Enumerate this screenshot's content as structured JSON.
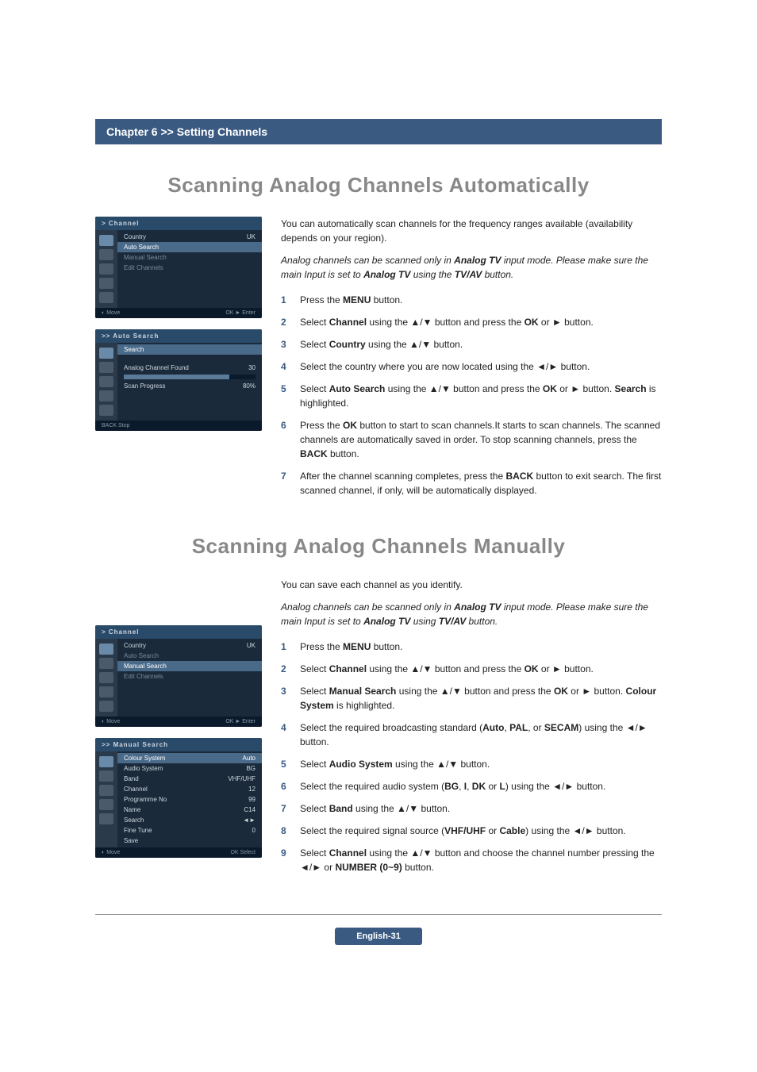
{
  "chapter_bar": "Chapter 6 >> Setting Channels",
  "section1": {
    "title": "Scanning Analog Channels Automatically",
    "intro": "You can automatically scan channels for the frequency ranges available (availability depends on your region).",
    "note_prefix": "Analog channels can be scanned only in ",
    "note_bold1": "Analog TV",
    "note_mid": " input mode. Please make sure the main Input is set to ",
    "note_bold2": "Analog TV",
    "note_suffix": " using the ",
    "note_bold3": "TV/AV",
    "note_end": " button.",
    "steps": {
      "s1a": "Press the ",
      "s1b": "MENU",
      "s1c": " button.",
      "s2a": "Select ",
      "s2b": "Channel",
      "s2c": " using the ▲/▼ button and press the ",
      "s2d": "OK",
      "s2e": " or ► button.",
      "s3a": "Select ",
      "s3b": "Country",
      "s3c": " using the ▲/▼ button.",
      "s4": "Select the country where you are now located using the ◄/► button.",
      "s5a": "Select ",
      "s5b": "Auto Search",
      "s5c": " using the ▲/▼ button and press the ",
      "s5d": "OK",
      "s5e": " or ► button. ",
      "s5f": "Search",
      "s5g": " is highlighted.",
      "s6a": "Press the ",
      "s6b": "OK",
      "s6c": " button to start to scan channels.It starts to scan channels. The scanned channels are automatically saved in order. To stop scanning channels, press the ",
      "s6d": "BACK",
      "s6e": " button.",
      "s7a": "After the channel scanning completes, press the ",
      "s7b": "BACK",
      "s7c": " button to exit search. The first scanned channel, if only, will be automatically displayed."
    },
    "osd1": {
      "title": "> Channel",
      "rows": [
        {
          "l": "Country",
          "r": "UK"
        },
        {
          "l": "Auto Search",
          "r": ""
        },
        {
          "l": "Manual Search",
          "r": ""
        },
        {
          "l": "Edit Channels",
          "r": ""
        }
      ],
      "footer_l": "Move",
      "footer_r": "Enter"
    },
    "osd2": {
      "title": ">> Auto Search",
      "search_label": "Search",
      "found_label": "Analog Channel Found",
      "found_value": "30",
      "progress_label": "Scan Progress",
      "progress_value": "80%",
      "footer_l": "BACK",
      "footer_r": "Stop"
    }
  },
  "section2": {
    "title": "Scanning Analog Channels Manually",
    "intro": "You can save each channel as you identify.",
    "note_prefix": "Analog channels can be scanned only in ",
    "note_bold1": "Analog TV",
    "note_mid": " input mode. Please make sure the main Input is set to ",
    "note_bold2": "Analog TV",
    "note_suffix": " using ",
    "note_bold3": "TV/AV",
    "note_end": " button.",
    "steps": {
      "s1a": "Press the ",
      "s1b": "MENU",
      "s1c": " button.",
      "s2a": "Select ",
      "s2b": "Channel",
      "s2c": " using the ▲/▼ button and press the ",
      "s2d": "OK",
      "s2e": " or ► button.",
      "s3a": "Select ",
      "s3b": "Manual Search",
      "s3c": " using the ▲/▼ button and press the ",
      "s3d": "OK",
      "s3e": " or ► button. ",
      "s3f": "Colour System",
      "s3g": " is highlighted.",
      "s4a": "Select the required broadcasting standard (",
      "s4b": "Auto",
      "s4c": ", ",
      "s4d": "PAL",
      "s4e": ", or ",
      "s4f": "SECAM",
      "s4g": ") using the ◄/► button.",
      "s5a": "Select ",
      "s5b": "Audio System",
      "s5c": " using the ▲/▼ button.",
      "s6a": "Select the required audio system (",
      "s6b": "BG",
      "s6c": ", ",
      "s6d": "I",
      "s6e": ", ",
      "s6f": "DK",
      "s6g": " or ",
      "s6h": "L",
      "s6i": ") using the ◄/► button.",
      "s7a": "Select ",
      "s7b": "Band",
      "s7c": " using the ▲/▼ button.",
      "s8a": "Select the required signal source (",
      "s8b": "VHF/UHF",
      "s8c": " or ",
      "s8d": "Cable",
      "s8e": ") using the ◄/► button.",
      "s9a": "Select ",
      "s9b": "Channel",
      "s9c": " using the ▲/▼ button and choose the channel number pressing the ◄/► or ",
      "s9d": "NUMBER (0~9)",
      "s9e": " button."
    },
    "osd1": {
      "title": "> Channel",
      "rows": [
        {
          "l": "Country",
          "r": "UK"
        },
        {
          "l": "Auto Search",
          "r": ""
        },
        {
          "l": "Manual Search",
          "r": ""
        },
        {
          "l": "Edit Channels",
          "r": ""
        }
      ],
      "footer_l": "Move",
      "footer_r": "Enter"
    },
    "osd2": {
      "title": ">> Manual Search",
      "rows": [
        {
          "l": "Colour System",
          "r": "Auto"
        },
        {
          "l": "Audio System",
          "r": "BG"
        },
        {
          "l": "Band",
          "r": "VHF/UHF"
        },
        {
          "l": "Channel",
          "r": "12"
        },
        {
          "l": "Programme No",
          "r": "99"
        },
        {
          "l": "Name",
          "r": "C14"
        },
        {
          "l": "Search",
          "r": "◄►"
        },
        {
          "l": "Fine Tune",
          "r": "0"
        },
        {
          "l": "Save",
          "r": ""
        }
      ],
      "footer_l": "Move",
      "footer_r": "Select"
    }
  },
  "page_footer": "English-31",
  "nums": {
    "n1": "1",
    "n2": "2",
    "n3": "3",
    "n4": "4",
    "n5": "5",
    "n6": "6",
    "n7": "7",
    "n8": "8",
    "n9": "9"
  }
}
